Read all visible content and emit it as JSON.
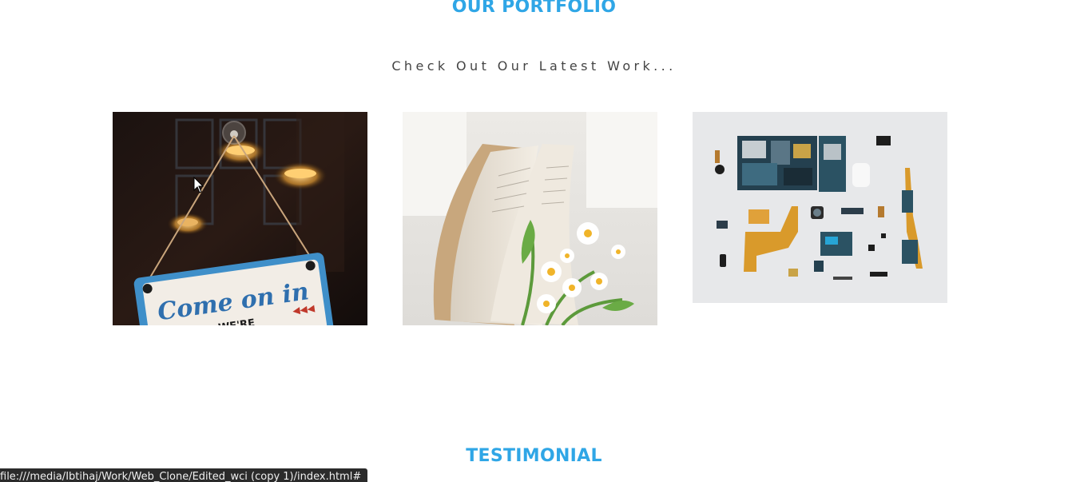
{
  "portfolio": {
    "title": "OUR PORTFOLIO",
    "subtitle": "Check Out Our Latest Work...",
    "items": [
      {
        "name": "open-sign-photo",
        "sign_line1": "Come on in",
        "sign_line2": "WE'RE"
      },
      {
        "name": "book-flowers-photo"
      },
      {
        "name": "phone-parts-photo"
      }
    ]
  },
  "testimonial": {
    "title": "TESTIMONIAL"
  },
  "status_bar": {
    "url": "file:///media/Ibtihaj/Work/Web_Clone/Edited_wci (copy 1)/index.html#"
  },
  "colors": {
    "accent": "#2fa6e6",
    "subtitle": "#444444",
    "status_bg": "#2b2b2b"
  }
}
